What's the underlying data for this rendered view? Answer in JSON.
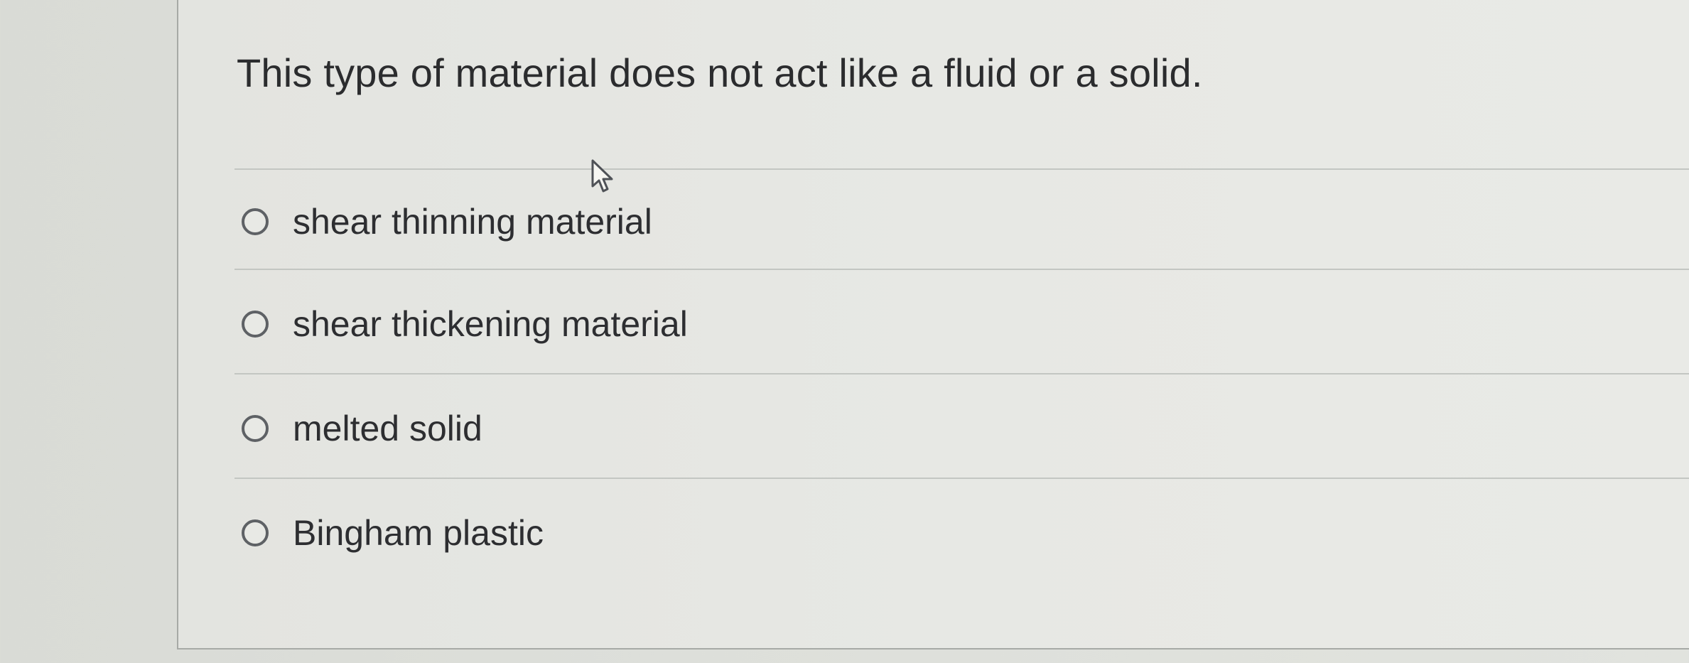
{
  "question": {
    "text": "This type of material does not act like a fluid or a solid."
  },
  "options": [
    {
      "label": "shear thinning material",
      "selected": false
    },
    {
      "label": "shear thickening material",
      "selected": false
    },
    {
      "label": "melted solid",
      "selected": false
    },
    {
      "label": "Bingham plastic",
      "selected": false
    }
  ],
  "cursor": {
    "icon": "pointer-arrow-icon"
  }
}
